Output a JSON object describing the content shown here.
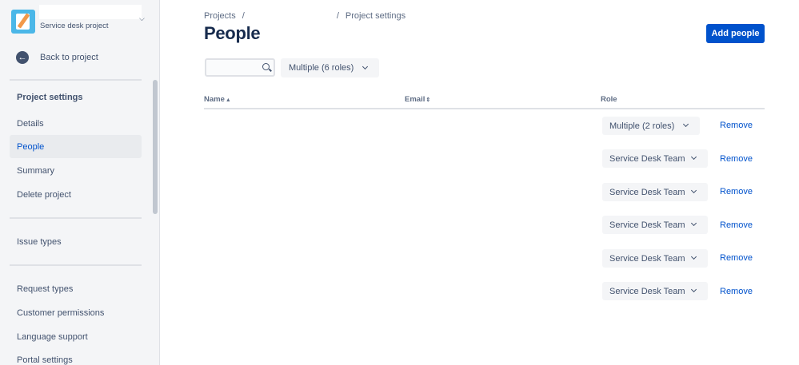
{
  "sidebar": {
    "project_type": "Service desk project",
    "back_label": "Back to project",
    "section_title": "Project settings",
    "items": [
      {
        "label": "Details"
      },
      {
        "label": "People"
      },
      {
        "label": "Summary"
      },
      {
        "label": "Delete project"
      },
      {
        "label": "Issue types"
      },
      {
        "label": "Request types"
      },
      {
        "label": "Customer permissions"
      },
      {
        "label": "Language support"
      },
      {
        "label": "Portal settings"
      }
    ]
  },
  "breadcrumb": {
    "projects": "Projects",
    "sep": "/",
    "current": "Project settings"
  },
  "page": {
    "title": "People",
    "add_button": "Add people"
  },
  "filter": {
    "search_value": "",
    "role_filter": "Multiple (6 roles)"
  },
  "table": {
    "headers": {
      "name": "Name",
      "email": "Email",
      "role": "Role"
    },
    "sort_asc": "▲",
    "sort_none": "⇕",
    "rows": [
      {
        "role": "Multiple (2 roles)",
        "action": "Remove"
      },
      {
        "role": "Service Desk Team",
        "action": "Remove"
      },
      {
        "role": "Service Desk Team",
        "action": "Remove"
      },
      {
        "role": "Service Desk Team",
        "action": "Remove"
      },
      {
        "role": "Service Desk Team",
        "action": "Remove"
      },
      {
        "role": "Service Desk Team",
        "action": "Remove"
      }
    ]
  },
  "icons": {
    "project_avatar": "notepad-pencil-icon",
    "back": "arrow-left-circle-icon",
    "search": "search-icon",
    "dropdown": "chevron-down-icon"
  },
  "colors": {
    "primary": "#0052cc",
    "text": "#172b4d",
    "subtle": "#42526e",
    "sidebar_bg": "#f4f5f7"
  }
}
